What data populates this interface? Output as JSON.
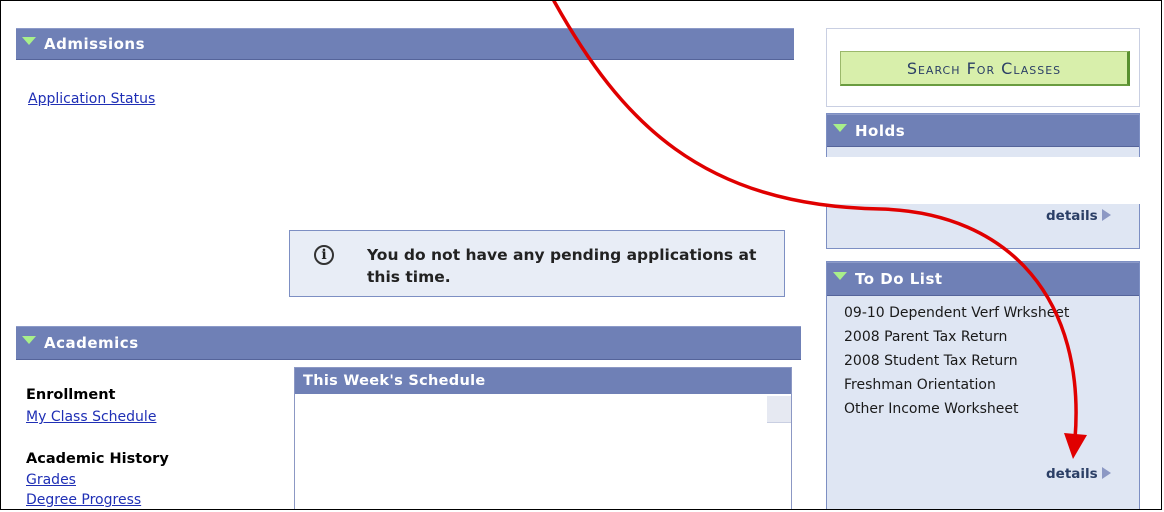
{
  "admissions": {
    "title": "Admissions",
    "link": "Application Status",
    "message": "You do not have any pending applications at this time.",
    "info_icon": "i"
  },
  "academics": {
    "title": "Academics",
    "enrollment_label": "Enrollment",
    "enrollment_link": "My Class Schedule",
    "history_label": "Academic History",
    "history_links": [
      "Grades",
      "Degree Progress"
    ],
    "schedule_title": "This Week's Schedule"
  },
  "search": {
    "button_label": "Search For Classes"
  },
  "holds": {
    "title": "Holds",
    "details": "details"
  },
  "todo": {
    "title": "To Do List",
    "items": [
      "09-10 Dependent Verf Wrksheet",
      "2008 Parent Tax Return",
      "2008 Student Tax Return",
      "Freshman Orientation",
      "Other Income Worksheet"
    ],
    "details": "details"
  },
  "colors": {
    "header_bg": "#6f80b6",
    "panel_bg": "#dfe6f3",
    "link": "#1f2fb5",
    "annotation_arrow": "#e00000",
    "button_bg": "#d8efab"
  }
}
